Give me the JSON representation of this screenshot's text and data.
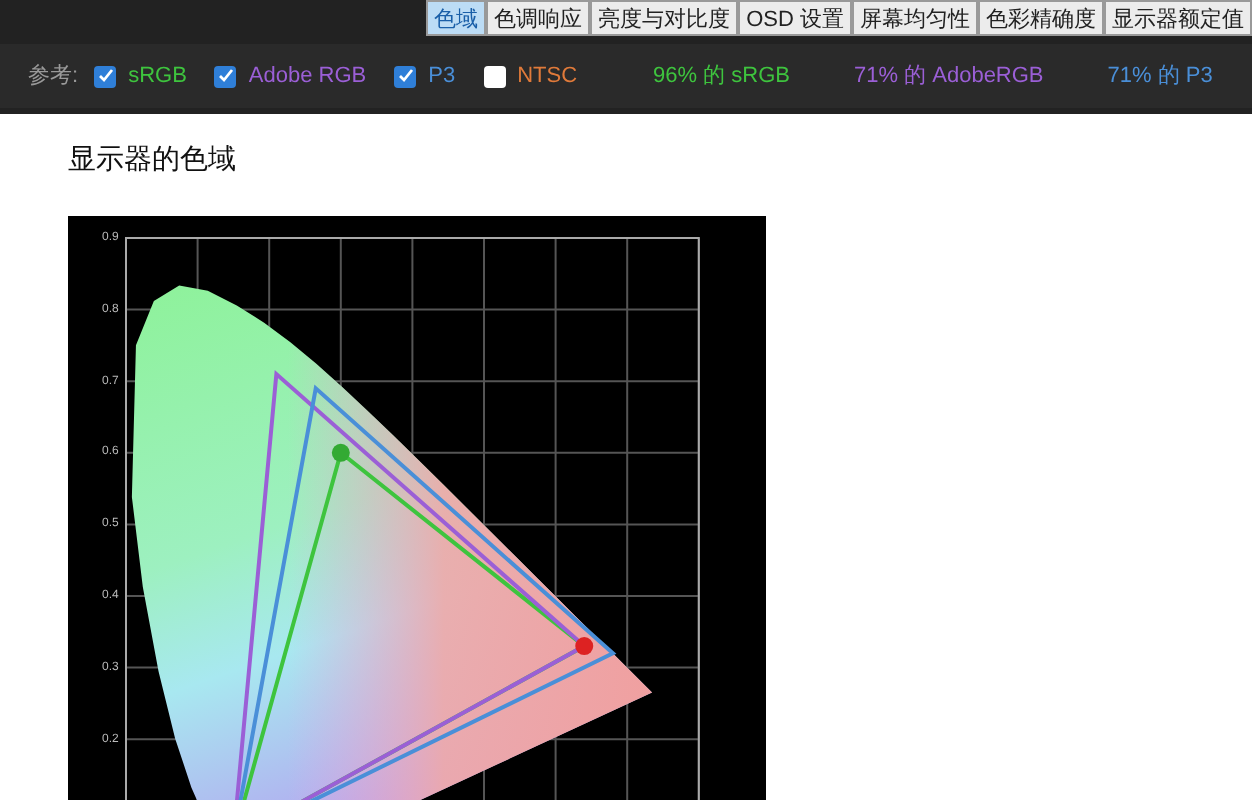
{
  "tabs": [
    {
      "label": "色域",
      "selected": true
    },
    {
      "label": "色调响应",
      "selected": false
    },
    {
      "label": "亮度与对比度",
      "selected": false
    },
    {
      "label": "OSD 设置",
      "selected": false
    },
    {
      "label": "屏幕均匀性",
      "selected": false
    },
    {
      "label": "色彩精确度",
      "selected": false
    },
    {
      "label": "显示器额定值",
      "selected": false
    }
  ],
  "reference": {
    "label": "参考:",
    "options": [
      {
        "label": "sRGB",
        "checked": true,
        "color": "#3ec43e"
      },
      {
        "label": "Adobe RGB",
        "checked": true,
        "color": "#9b5fd6"
      },
      {
        "label": "P3",
        "checked": true,
        "color": "#4a8fd8"
      },
      {
        "label": "NTSC",
        "checked": false,
        "color": "#e07a3a"
      }
    ],
    "results": [
      {
        "text": "96% 的 sRGB",
        "color": "#3ec43e"
      },
      {
        "text": "71% 的 AdobeRGB",
        "color": "#9b5fd6"
      },
      {
        "text": "71% 的 P3",
        "color": "#4a8fd8"
      }
    ]
  },
  "section_title": "显示器的色域",
  "chart": {
    "y_tick_labels": [
      "0.9",
      "0.8",
      "0.7",
      "0.6",
      "0.5",
      "0.4",
      "0.3",
      "0.2"
    ]
  }
}
